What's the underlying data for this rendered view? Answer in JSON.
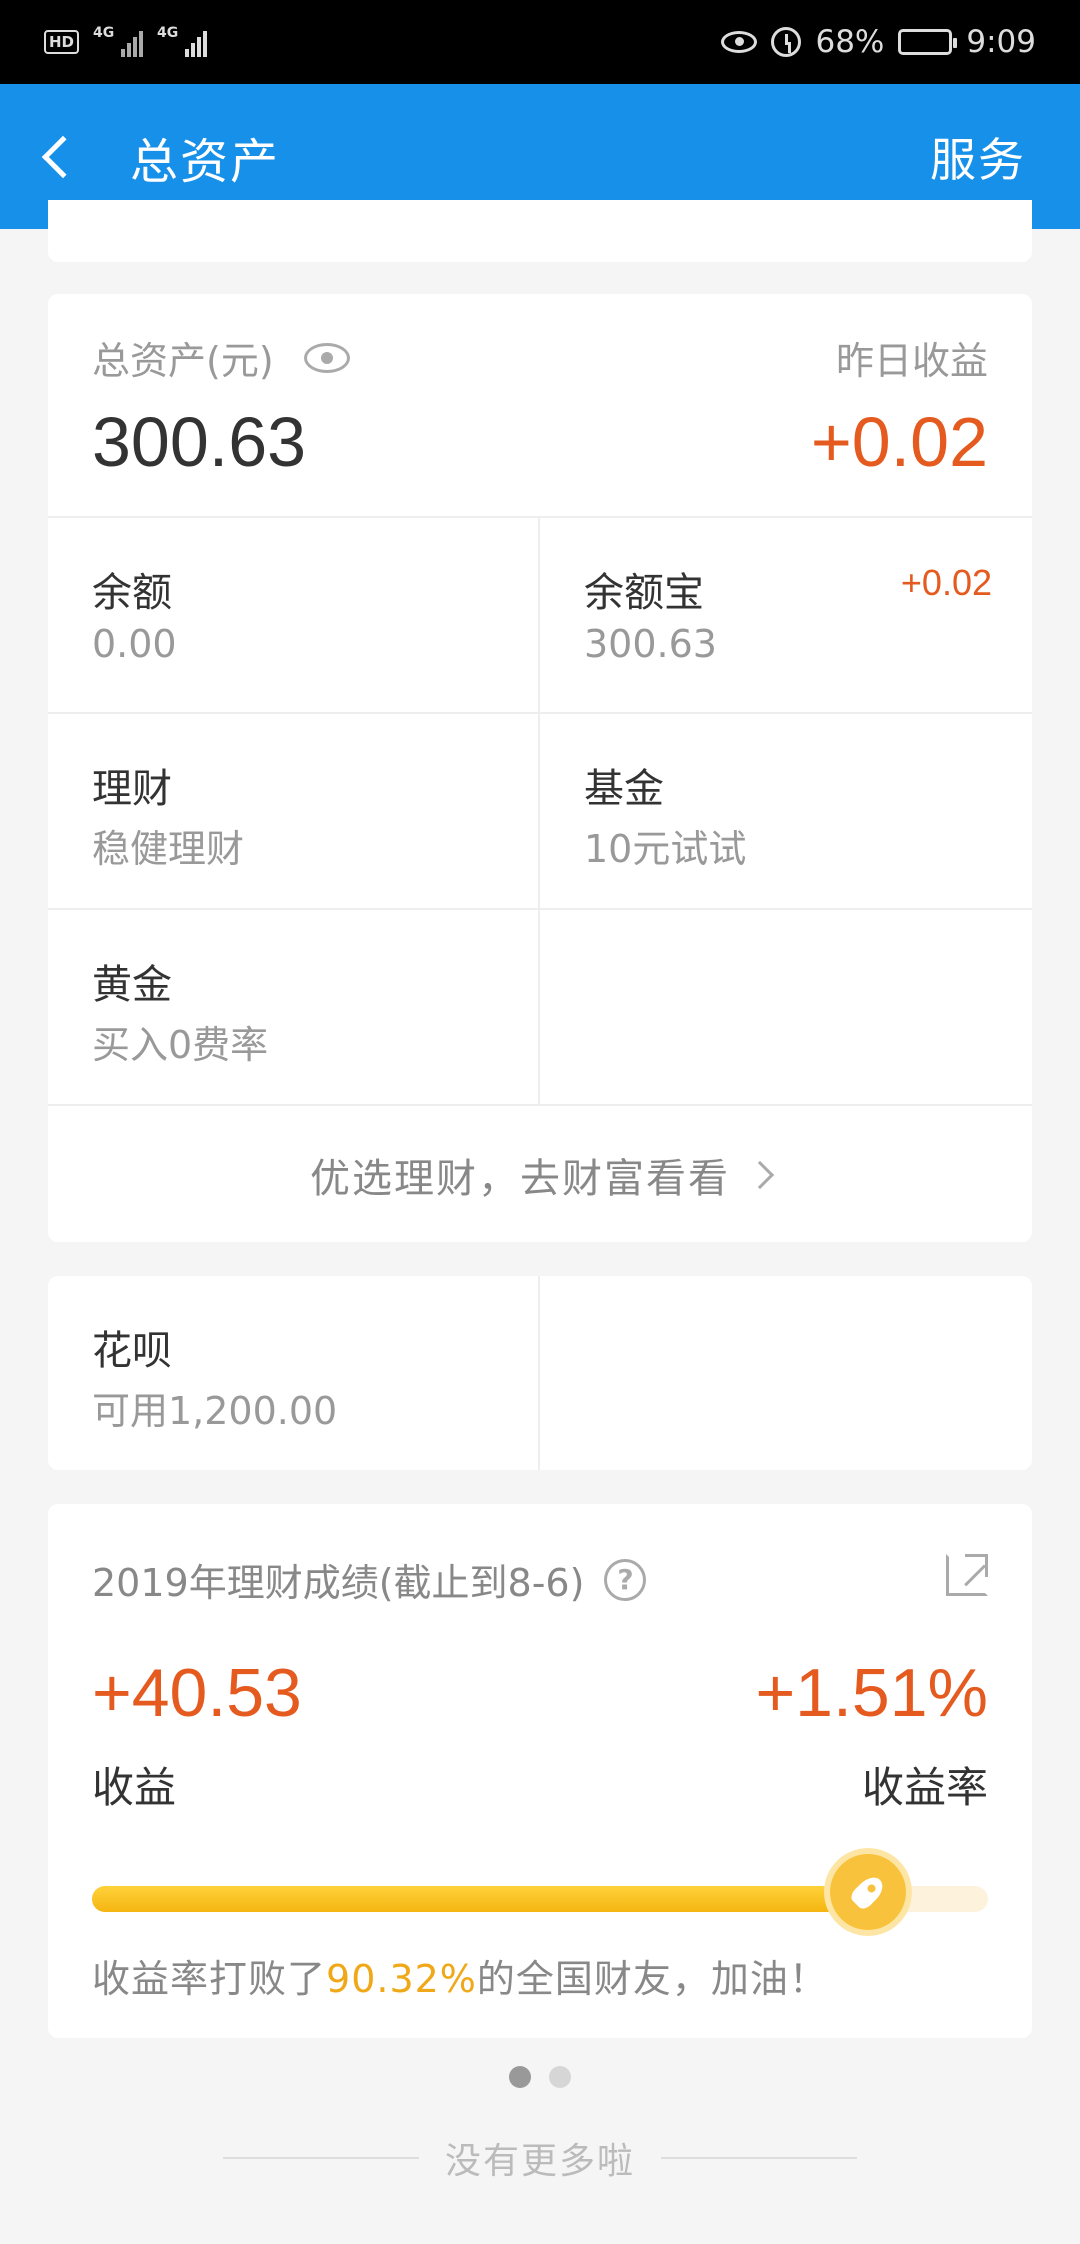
{
  "status_bar": {
    "hd": "HD",
    "network_1": "4G",
    "network_2": "4G",
    "battery": "68%",
    "time": "9:09"
  },
  "nav": {
    "title": "总资产",
    "action": "服务"
  },
  "assets": {
    "total_label": "总资产(元)",
    "total_value": "300.63",
    "yesterday_label": "昨日收益",
    "yesterday_value": "+0.02",
    "items": [
      {
        "title": "余额",
        "sub": "0.00",
        "badge": ""
      },
      {
        "title": "余额宝",
        "sub": "300.63",
        "badge": "+0.02"
      },
      {
        "title": "理财",
        "sub": "稳健理财",
        "badge": ""
      },
      {
        "title": "基金",
        "sub": "10元试试",
        "badge": ""
      },
      {
        "title": "黄金",
        "sub": "买入0费率",
        "badge": ""
      }
    ],
    "more_link": "优选理财，去财富看看"
  },
  "huabei": {
    "title": "花呗",
    "sub": "可用1,200.00"
  },
  "performance": {
    "title": "2019年理财成绩(截止到8-6)",
    "help": "?",
    "gain_value": "+40.53",
    "gain_label": "收益",
    "rate_value": "+1.51%",
    "rate_label": "收益率",
    "progress_fraction": 0.866,
    "beat_prefix": "收益率打败了",
    "beat_pct": "90.32%",
    "beat_suffix": "的全国财友，加油！"
  },
  "footer": {
    "end_text": "没有更多啦"
  },
  "colors": {
    "nav_blue": "#1790ea",
    "accent_orange": "#e45a1f",
    "highlight_gold": "#f0a818"
  },
  "icons": [
    "back-chevron-icon",
    "eye-icon",
    "chevron-right-icon",
    "help-icon",
    "share-icon",
    "rocket-icon"
  ]
}
